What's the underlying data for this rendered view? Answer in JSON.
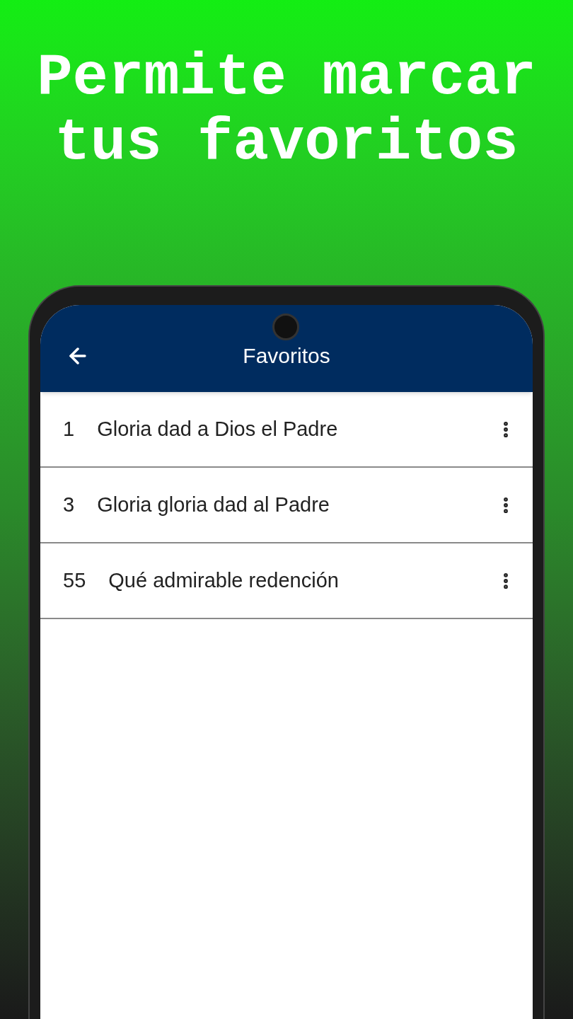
{
  "headline": "Permite marcar tus favoritos",
  "app_bar": {
    "title": "Favoritos"
  },
  "favorites": [
    {
      "number": "1",
      "title": "Gloria dad a Dios el Padre"
    },
    {
      "number": "3",
      "title": "Gloria gloria dad al Padre"
    },
    {
      "number": "55",
      "title": "Qué admirable redención"
    }
  ]
}
